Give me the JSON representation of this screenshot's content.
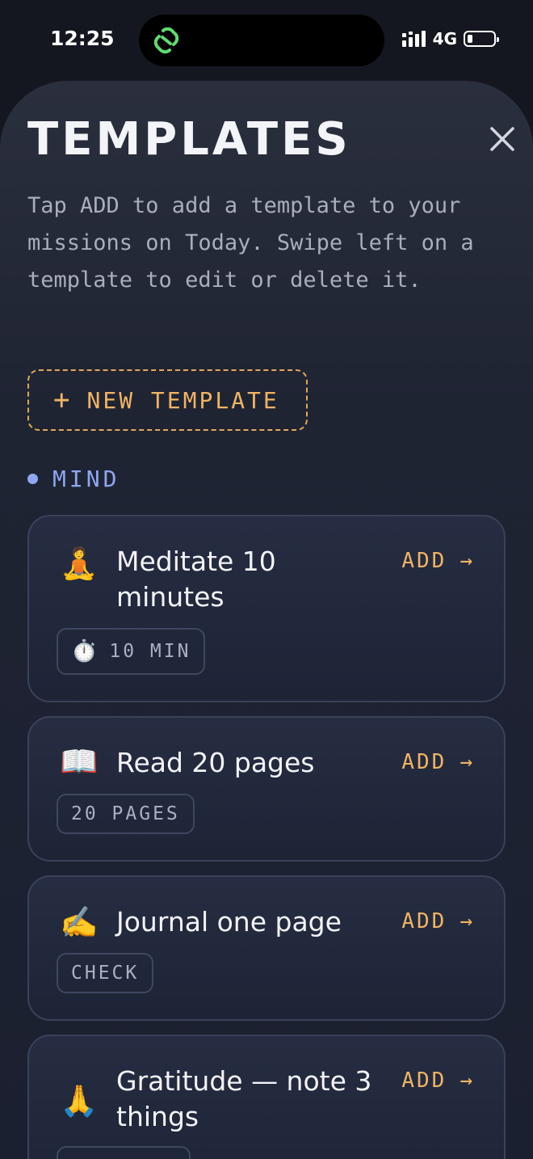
{
  "status": {
    "time": "12:25",
    "network": "4G",
    "battery_level": 0.2
  },
  "header": {
    "title": "TEMPLATES",
    "subtitle": "Tap ADD to add a template to your missions on Today. Swipe left on a template to edit or delete it."
  },
  "new_template": {
    "plus": "+",
    "label": "NEW TEMPLATE"
  },
  "section": {
    "label": "MIND",
    "color": "#8fa6f0"
  },
  "accent_color": "#f0b464",
  "templates": [
    {
      "emoji": "🧘",
      "title": "Meditate 10 minutes",
      "add_label": "ADD",
      "arrow": "→",
      "tag_icon": "⏱️",
      "tag": "10 MIN"
    },
    {
      "emoji": "📖",
      "title": "Read 20 pages",
      "add_label": "ADD",
      "arrow": "→",
      "tag": "20 PAGES"
    },
    {
      "emoji": "✍️",
      "title": "Journal one page",
      "add_label": "ADD",
      "arrow": "→",
      "tag": "CHECK"
    },
    {
      "emoji": "🙏",
      "title": "Gratitude — note 3 things",
      "add_label": "ADD",
      "arrow": "→"
    }
  ]
}
